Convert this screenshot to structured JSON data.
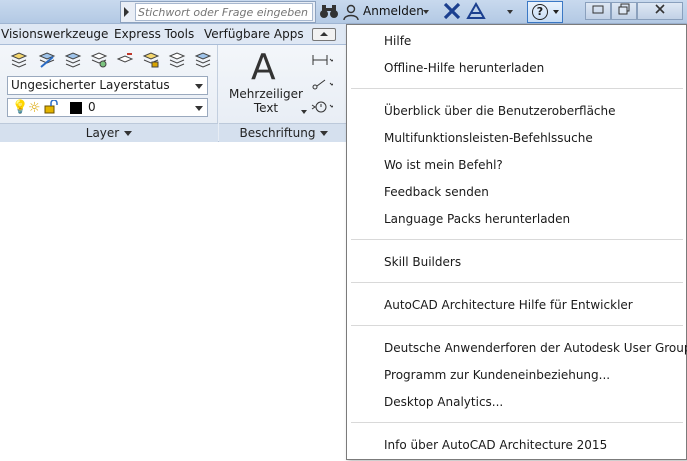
{
  "titlebar": {
    "search_placeholder": "Stichwort oder Frage eingeben",
    "login_label": "Anmelden",
    "window_min": "▭",
    "window_restore": "❐",
    "window_close": "✕"
  },
  "ribbon": {
    "tabs": [
      {
        "label": "Visionswerkzeuge"
      },
      {
        "label": "Express Tools"
      },
      {
        "label": "Verfügbare Apps"
      }
    ],
    "layer_panel": {
      "combo_value": "Ungesicherter Layerstatus",
      "current_layer": "0",
      "title": "Layer"
    },
    "annotation_panel": {
      "mtext_line1": "Mehrzeiliger",
      "mtext_line2": "Text",
      "title": "Beschriftung"
    }
  },
  "help_menu": {
    "items": [
      {
        "label": "Hilfe"
      },
      {
        "label": "Offline-Hilfe herunterladen"
      },
      {
        "label": "Überblick über die Benutzeroberfläche"
      },
      {
        "label": "Multifunktionsleisten-Befehlssuche"
      },
      {
        "label": "Wo ist mein Befehl?"
      },
      {
        "label": "Feedback senden"
      },
      {
        "label": "Language Packs herunterladen"
      },
      {
        "label": "Skill Builders"
      },
      {
        "label": "AutoCAD Architecture Hilfe für Entwickler"
      },
      {
        "label": "Deutsche Anwenderforen der Autodesk User Group"
      },
      {
        "label": "Programm zur Kundeneinbeziehung..."
      },
      {
        "label": "Desktop Analytics..."
      },
      {
        "label": "Info über AutoCAD Architecture 2015"
      }
    ]
  },
  "colors": {
    "titlebar": "#c8d9ee",
    "accent": "#3a78c5",
    "layer_swatch": "#000000"
  }
}
